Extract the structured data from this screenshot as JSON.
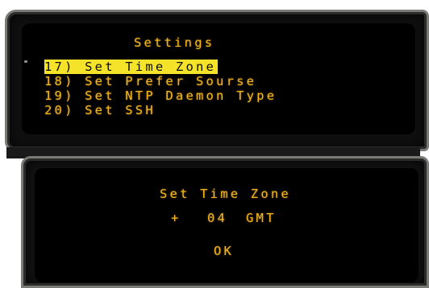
{
  "menu": {
    "title": "Settings",
    "items": [
      {
        "label": "17) Set Time Zone",
        "selected": true
      },
      {
        "label": "18) Set Prefer Sourse",
        "selected": false
      },
      {
        "label": "19) Set NTP Daemon Type",
        "selected": false
      },
      {
        "label": "20) Set SSH",
        "selected": false
      }
    ]
  },
  "dialog": {
    "title": "Set Time Zone",
    "sign": "+",
    "value": "04",
    "unit": "GMT",
    "ok_label": "OK"
  },
  "colors": {
    "lcd_text": "#f2b51f",
    "highlight": "#f5e32a"
  }
}
